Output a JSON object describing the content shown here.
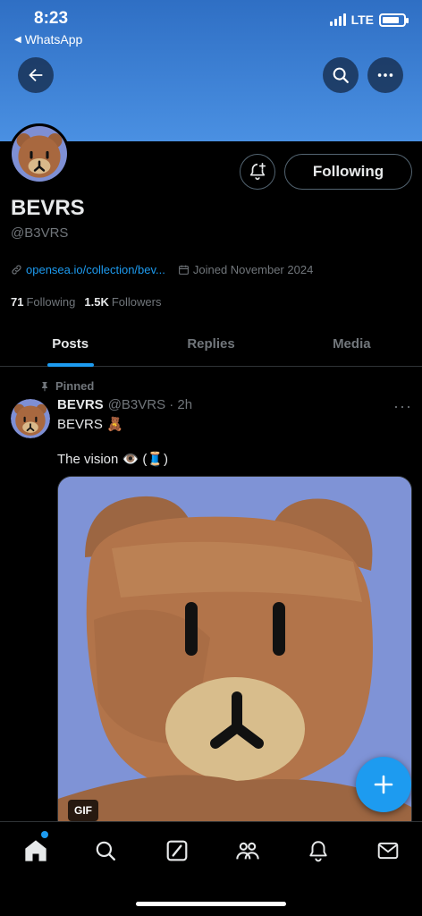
{
  "status_bar": {
    "time": "8:23",
    "back_app": "WhatsApp",
    "network": "LTE"
  },
  "header": {
    "back_icon": "arrow-left-icon",
    "search_icon": "search-icon",
    "more_icon": "more-horizontal-icon",
    "banner_color": "#4a90e2"
  },
  "profile": {
    "display_name": "BEVRS",
    "handle": "@B3VRS",
    "link": "opensea.io/collection/bev...",
    "joined": "Joined November 2024",
    "following_count": "71",
    "following_label": "Following",
    "followers_count": "1.5K",
    "followers_label": "Followers",
    "follow_button": "Following"
  },
  "tabs": [
    {
      "label": "Posts",
      "active": true
    },
    {
      "label": "Replies",
      "active": false
    },
    {
      "label": "Media",
      "active": false
    }
  ],
  "post": {
    "pinned_label": "Pinned",
    "author_name": "BEVRS",
    "author_handle": "@B3VRS · 2h",
    "more": "···",
    "line1": "BEVRS 🧸",
    "line2": "The vision 👁️ (🧵)",
    "media_badge": "GIF"
  },
  "bottom_nav": [
    "home-icon",
    "search-icon",
    "compose-grok-icon",
    "communities-icon",
    "notifications-icon",
    "messages-icon"
  ],
  "colors": {
    "accent": "#1d9bf0",
    "background": "#000000",
    "muted_text": "#71767b"
  }
}
